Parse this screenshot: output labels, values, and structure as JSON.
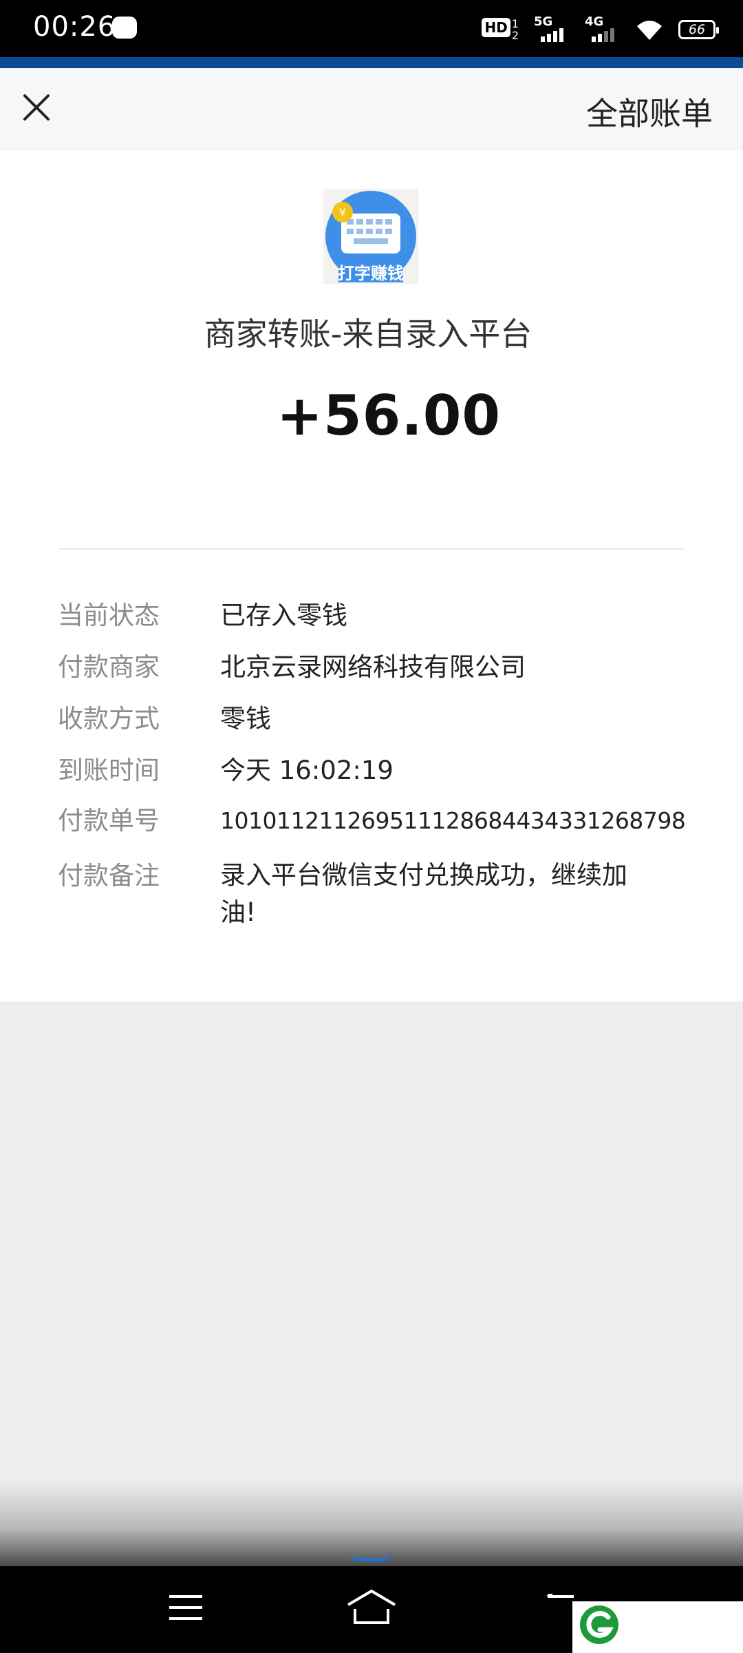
{
  "status_bar": {
    "time": "00:26",
    "hd_label": "HD",
    "hd_nums": [
      "1",
      "2"
    ],
    "network_1": "5G",
    "network_2": "4G",
    "battery": "66"
  },
  "header": {
    "close_icon": "close-icon",
    "all_bills_label": "全部账单"
  },
  "transaction": {
    "merchant_logo_text": "打字赚钱",
    "title": "商家转账-来自录入平台",
    "amount": "+56.00",
    "details": [
      {
        "label": "当前状态",
        "value": "已存入零钱"
      },
      {
        "label": "付款商家",
        "value": "北京云录网络科技有限公司"
      },
      {
        "label": "收款方式",
        "value": "零钱"
      },
      {
        "label": "到账时间",
        "value": "今天 16:02:19"
      },
      {
        "label": "付款单号",
        "value": "101011211269511128684434331268798"
      },
      {
        "label": "付款备注",
        "value": "录入平台微信支付兑换成功，继续加油!"
      }
    ]
  },
  "nav_bar": {
    "menu_icon": "menu-icon",
    "home_icon": "home-icon",
    "back_icon": "back-icon"
  },
  "colors": {
    "accent_blue": "#0b4c97",
    "logo_blue": "#3f8fe8",
    "coin_gold": "#f3c21a",
    "watermark_green": "#1f9a3a"
  }
}
